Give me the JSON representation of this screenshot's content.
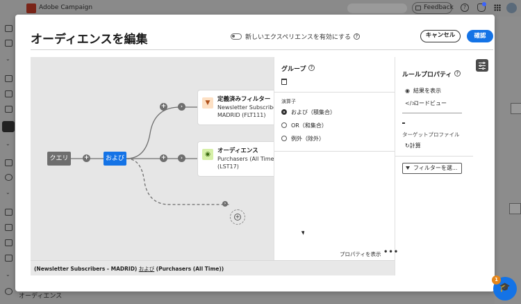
{
  "app": {
    "name": "Adobe Campaign",
    "feedback_label": "Feedback",
    "bottom_nav_label": "オーディエンス"
  },
  "modal": {
    "title": "オーディエンスを編集",
    "toggle_label": "新しいエクスペリエンスを有効にする",
    "cancel_label": "キャンセル",
    "confirm_label": "確認"
  },
  "canvas": {
    "query_label": "クエリ",
    "and_label": "および",
    "card1": {
      "title": "定義済みフィルター",
      "line1": "Newsletter Subscribers -",
      "line2": "MADRID (FLT111)"
    },
    "card2": {
      "title": "オーディエンス",
      "line1": "Purchasers (All Time)",
      "line2": "(LST17)"
    }
  },
  "group_panel": {
    "title": "グループ",
    "operator_label": "演算子",
    "options": [
      {
        "label": "および（積集合）",
        "selected": true
      },
      {
        "label": "OR（和集合）",
        "selected": false
      },
      {
        "label": "例外（除外）",
        "selected": false
      }
    ]
  },
  "rule_panel": {
    "title": "ルールプロパティ",
    "show_results": "結果を表示",
    "code_view": "コードビュー",
    "dash": "-",
    "target_profile_label": "ターゲットプロファイル",
    "calculate": "計算",
    "filter_button": "フィルターを選..."
  },
  "bottom": {
    "show_properties": "プロパティを表示",
    "more": "•••",
    "summary_left": "(Newsletter Subscribers - MADRID)",
    "summary_op": "および",
    "summary_right": "(Purchasers (All Time))"
  },
  "help": {
    "badge_count": "1"
  },
  "colors": {
    "accent": "#1473e6",
    "node_gray": "#6e6e6e",
    "canvas_bg": "#e6e6e6"
  }
}
